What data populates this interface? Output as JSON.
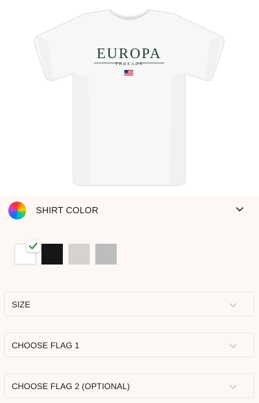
{
  "product": {
    "image_alt": "White t-shirt with EUROPA THREADS print and US flag",
    "print_brand": "EUROPA",
    "print_sub": "THREADS"
  },
  "shirt_color": {
    "label": "SHIRT COLOR",
    "swatches": [
      {
        "name": "white",
        "color": "#ffffff",
        "selected": true
      },
      {
        "name": "black",
        "color": "#161616",
        "selected": false
      },
      {
        "name": "light-gray",
        "color": "#d6d3cf",
        "selected": false
      },
      {
        "name": "gray",
        "color": "#bdbdbd",
        "selected": false
      }
    ]
  },
  "size": {
    "label": "SIZE"
  },
  "flag1": {
    "label": "CHOOSE FLAG 1"
  },
  "flag2": {
    "label": "CHOOSE FLAG 2 (OPTIONAL)"
  },
  "colors": {
    "panel_bg": "#fdf8f5",
    "check_green": "#2e9d3a",
    "print_green": "#1f3a2e"
  }
}
